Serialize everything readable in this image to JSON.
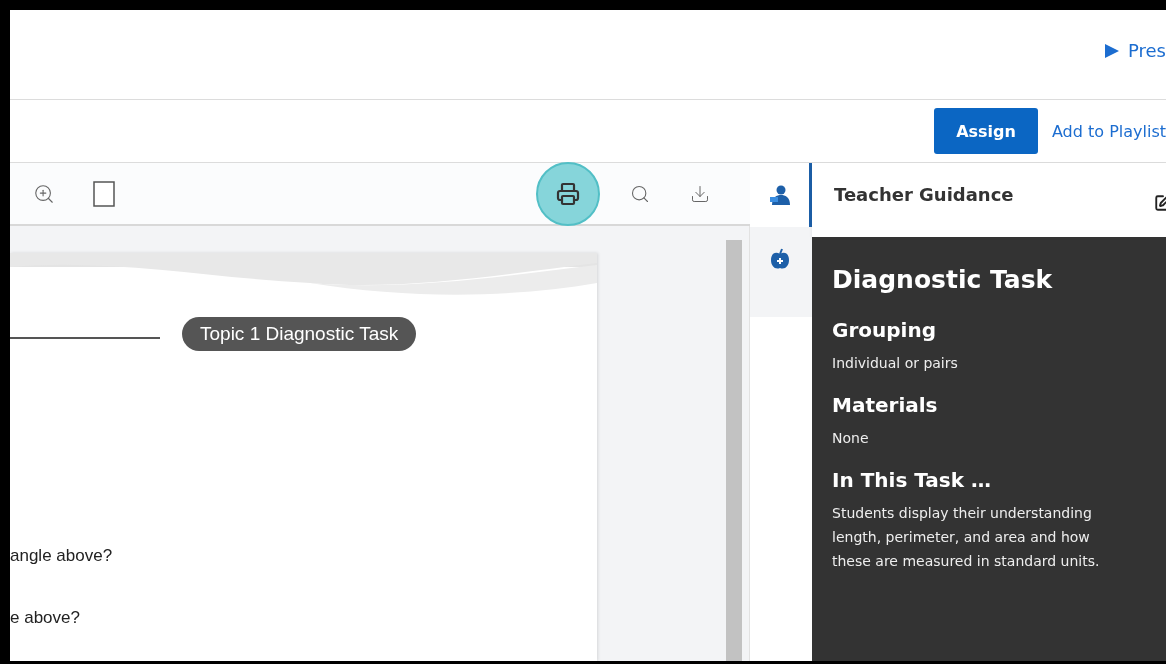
{
  "top_bar": {
    "present_link": "Pres"
  },
  "action_bar": {
    "assign_button": "Assign",
    "playlist_link": "Add to Playlist"
  },
  "viewer_toolbar": {
    "tools": [
      {
        "kind": "zoom-in",
        "selected": false
      },
      {
        "kind": "page",
        "selected": false
      },
      {
        "kind": "print",
        "selected": true
      },
      {
        "kind": "search",
        "selected": false
      },
      {
        "kind": "download",
        "selected": false
      }
    ]
  },
  "document": {
    "title_tag": "Topic 1 Diagnostic Task",
    "lines": [
      "angle above?",
      "e above?"
    ]
  },
  "side_rail": {
    "items": [
      {
        "kind": "teacher",
        "selected": true
      },
      {
        "kind": "apple",
        "selected": false
      }
    ]
  },
  "guidance_panel": {
    "title": "Teacher Guidance",
    "heading": "Diagnostic Task",
    "sections": [
      {
        "heading": "Grouping",
        "lines": [
          "Individual or pairs"
        ]
      },
      {
        "heading": "Materials",
        "lines": [
          "None"
        ]
      },
      {
        "heading": "In This Task …",
        "lines": [
          "Students display their understanding",
          "length, perimeter, and area and how",
          "these are measured in standard units."
        ]
      }
    ]
  }
}
